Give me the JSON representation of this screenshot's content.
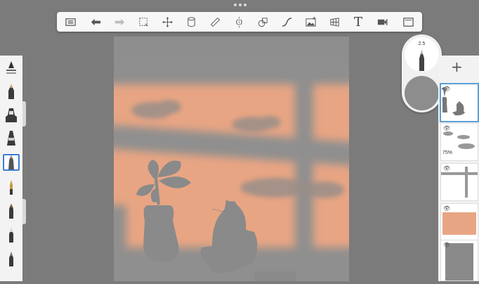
{
  "toolbar": {
    "icons": [
      "layers-list-icon",
      "undo-icon",
      "redo-icon",
      "selection-icon",
      "transform-icon",
      "fill-icon",
      "ruler-icon",
      "symmetry-icon",
      "shapes-icon",
      "curve-icon",
      "image-icon",
      "perspective-icon",
      "text-icon",
      "video-icon",
      "fullscreen-icon"
    ],
    "text_tool_label": "T"
  },
  "brush_puck": {
    "size": "2.5",
    "color": "#8d8d8d"
  },
  "layers_panel": {
    "add_label": "+",
    "layers": [
      {
        "name": "cat-and-vase",
        "opacity_label": "",
        "selected": true
      },
      {
        "name": "clouds",
        "opacity_label": "75%",
        "selected": false
      },
      {
        "name": "window-frame",
        "opacity_label": "",
        "selected": false
      },
      {
        "name": "background-orange",
        "opacity_label": "",
        "selected": false
      },
      {
        "name": "background-gray",
        "opacity_label": "",
        "selected": false
      }
    ]
  },
  "colors": {
    "background": "#7b7b7b",
    "wall": "#e8a583",
    "shadow": "#8f8f8f",
    "accent": "#3a7bd5"
  }
}
